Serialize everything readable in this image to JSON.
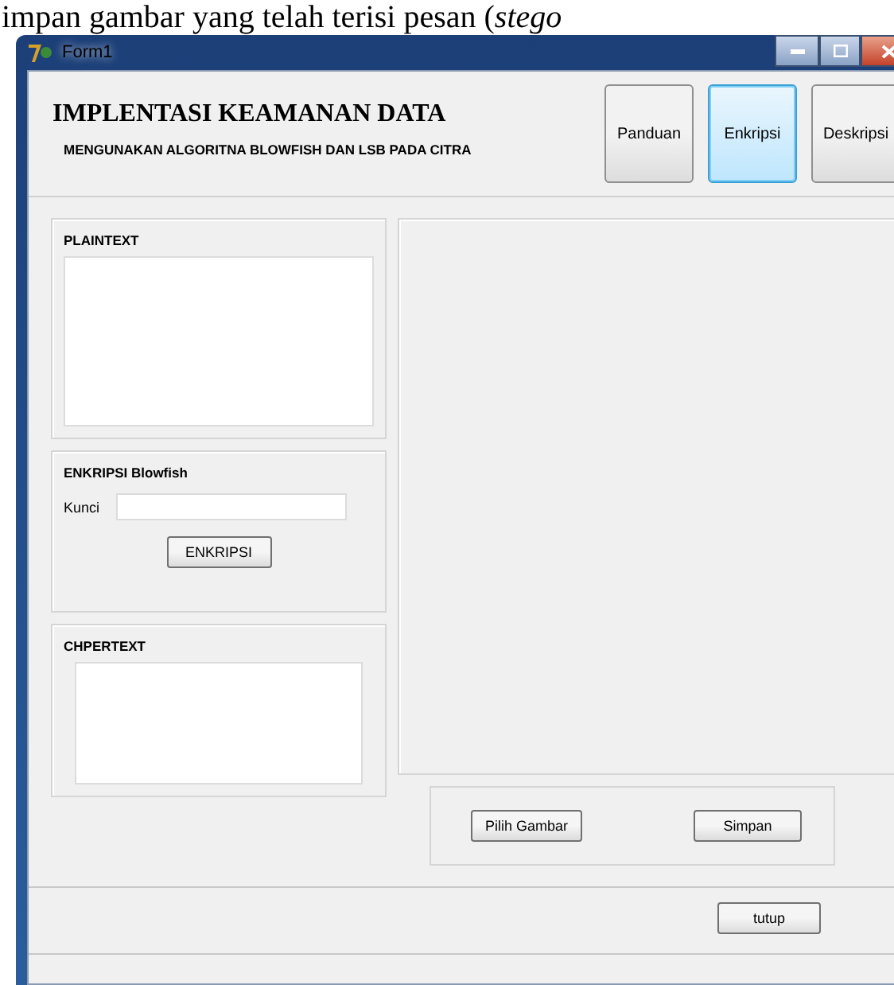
{
  "document_text": "impan gambar yang telah terisi pesan (*stego*",
  "window": {
    "title": "Form1"
  },
  "header": {
    "title": "IMPLENTASI KEAMANAN DATA",
    "subtitle": "MENGUNAKAN ALGORITNA BLOWFISH DAN LSB PADA CITRA"
  },
  "nav_buttons": [
    {
      "label": "Panduan",
      "selected": false
    },
    {
      "label": "Enkripsi",
      "selected": true
    },
    {
      "label": "Deskripsi",
      "selected": false
    }
  ],
  "plaintext": {
    "title": "PLAINTEXT"
  },
  "encrypt": {
    "title": "ENKRIPSI Blowfish",
    "key_label": "Kunci",
    "button": "ENKRIPSI"
  },
  "ciphertext": {
    "title": "CHPERTEXT"
  },
  "image_actions": [
    "Pilih Gambar",
    "Simpan"
  ],
  "close_button": "tutup"
}
